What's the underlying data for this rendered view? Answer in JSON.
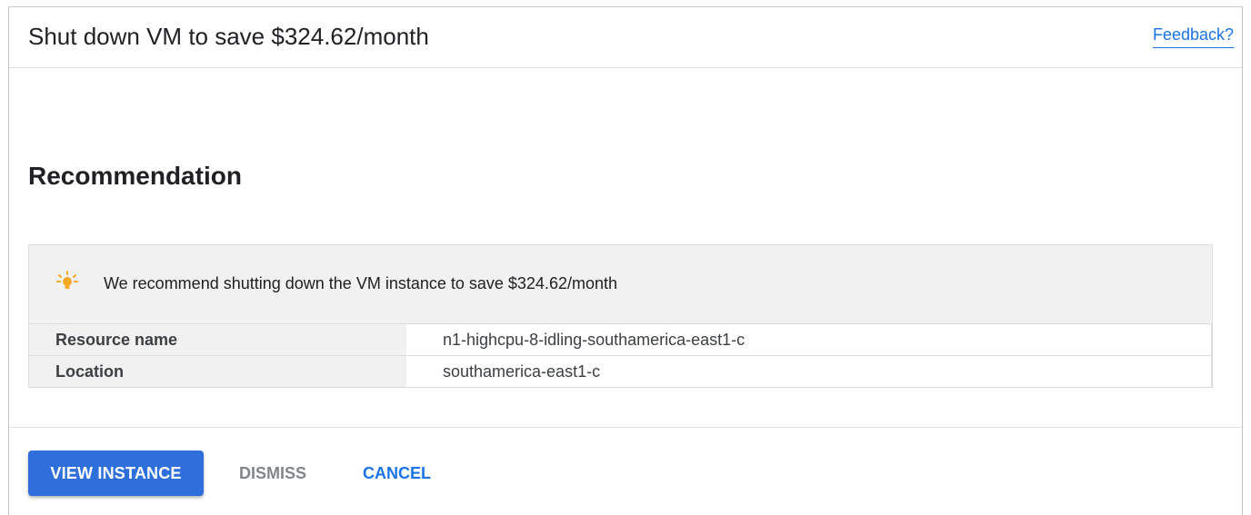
{
  "header": {
    "title": "Shut down VM to save $324.62/month",
    "feedback_label": "Feedback?"
  },
  "section": {
    "title": "Recommendation"
  },
  "recommendation": {
    "icon": "lightbulb-icon",
    "message": "We recommend shutting down the VM instance to save $324.62/month",
    "rows": [
      {
        "label": "Resource name",
        "value": "n1-highcpu-8-idling-southamerica-east1-c"
      },
      {
        "label": "Location",
        "value": "southamerica-east1-c"
      }
    ]
  },
  "actions": {
    "primary_label": "VIEW INSTANCE",
    "dismiss_label": "DISMISS",
    "cancel_label": "CANCEL"
  },
  "colors": {
    "primary": "#2f6fdc",
    "link": "#1a73e8",
    "bulb": "#f9a825"
  }
}
